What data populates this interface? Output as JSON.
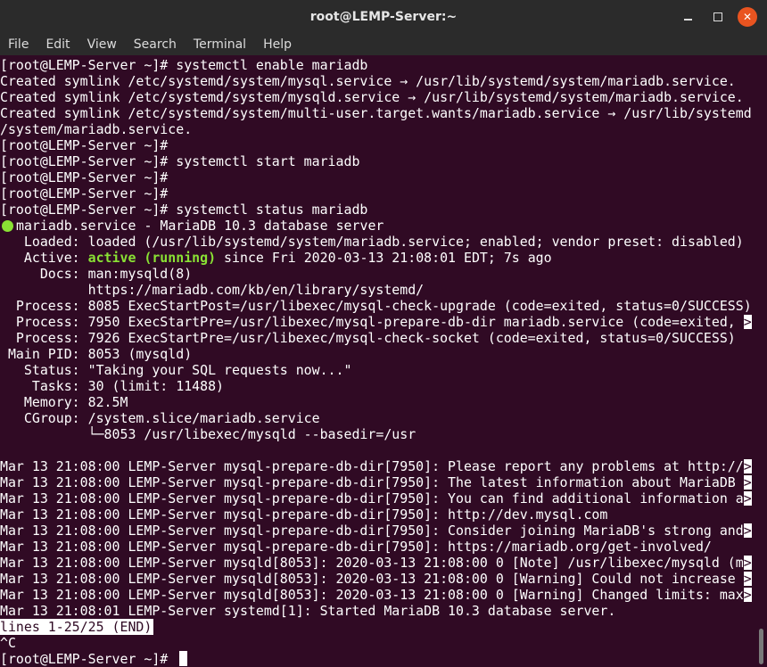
{
  "window": {
    "title": "root@LEMP-Server:~",
    "minimize_glyph": "",
    "maximize_glyph": "",
    "close_glyph": "✕"
  },
  "menubar": {
    "items": [
      "File",
      "Edit",
      "View",
      "Search",
      "Terminal",
      "Help"
    ]
  },
  "terminal": {
    "colors": {
      "background": "#300a24",
      "text": "#ffffff",
      "active": "#8ae234"
    },
    "lines": [
      "[root@LEMP-Server ~]# systemctl enable mariadb",
      "Created symlink /etc/systemd/system/mysql.service → /usr/lib/systemd/system/mariadb.service.",
      "Created symlink /etc/systemd/system/mysqld.service → /usr/lib/systemd/system/mariadb.service.",
      "Created symlink /etc/systemd/system/multi-user.target.wants/mariadb.service → /usr/lib/systemd",
      "/system/mariadb.service.",
      "[root@LEMP-Server ~]#",
      "[root@LEMP-Server ~]# systemctl start mariadb",
      "[root@LEMP-Server ~]#",
      "[root@LEMP-Server ~]#",
      "[root@LEMP-Server ~]# systemctl status mariadb",
      "mariadb.service - MariaDB 10.3 database server",
      "   Loaded: loaded (/usr/lib/systemd/system/mariadb.service; enabled; vendor preset: disabled)",
      "   Active: ",
      "active (running)",
      " since Fri 2020-03-13 21:08:01 EDT; 7s ago",
      "     Docs: man:mysqld(8)",
      "           https://mariadb.com/kb/en/library/systemd/",
      "  Process: 8085 ExecStartPost=/usr/libexec/mysql-check-upgrade (code=exited, status=0/SUCCESS)",
      "  Process: 7950 ExecStartPre=/usr/libexec/mysql-prepare-db-dir mariadb.service (code=exited, ",
      "  Process: 7926 ExecStartPre=/usr/libexec/mysql-check-socket (code=exited, status=0/SUCCESS)",
      " Main PID: 8053 (mysqld)",
      "   Status: \"Taking your SQL requests now...\"",
      "    Tasks: 30 (limit: 11488)",
      "   Memory: 82.5M",
      "   CGroup: /system.slice/mariadb.service",
      "           └─8053 /usr/libexec/mysqld --basedir=/usr",
      "",
      "Mar 13 21:08:00 LEMP-Server mysql-prepare-db-dir[7950]: Please report any problems at http://",
      "Mar 13 21:08:00 LEMP-Server mysql-prepare-db-dir[7950]: The latest information about MariaDB ",
      "Mar 13 21:08:00 LEMP-Server mysql-prepare-db-dir[7950]: You can find additional information a",
      "Mar 13 21:08:00 LEMP-Server mysql-prepare-db-dir[7950]: http://dev.mysql.com",
      "Mar 13 21:08:00 LEMP-Server mysql-prepare-db-dir[7950]: Consider joining MariaDB's strong and",
      "Mar 13 21:08:00 LEMP-Server mysql-prepare-db-dir[7950]: https://mariadb.org/get-involved/",
      "Mar 13 21:08:00 LEMP-Server mysqld[8053]: 2020-03-13 21:08:00 0 [Note] /usr/libexec/mysqld (m",
      "Mar 13 21:08:00 LEMP-Server mysqld[8053]: 2020-03-13 21:08:00 0 [Warning] Could not increase ",
      "Mar 13 21:08:00 LEMP-Server mysqld[8053]: 2020-03-13 21:08:00 0 [Warning] Changed limits: max",
      "Mar 13 21:08:01 LEMP-Server systemd[1]: Started MariaDB 10.3 database server.",
      "lines 1-25/25 (END)",
      "^C",
      "[root@LEMP-Server ~]# "
    ],
    "truncation_marker": ">"
  }
}
